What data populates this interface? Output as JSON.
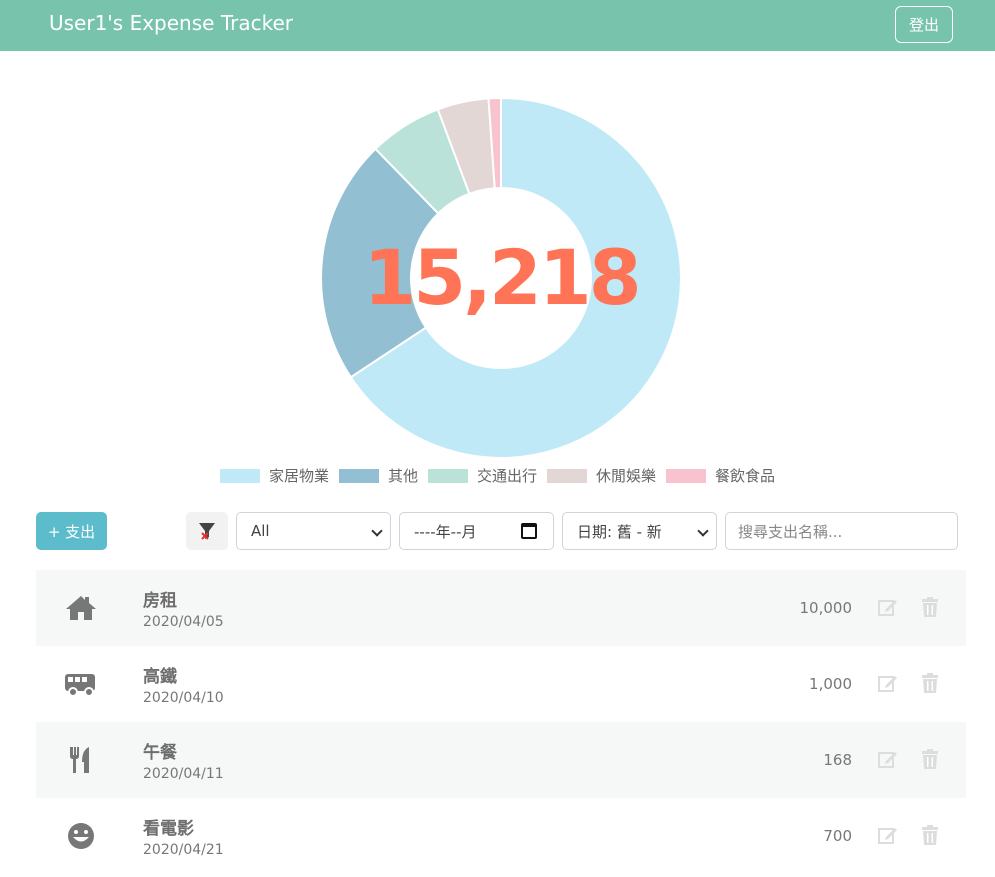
{
  "navbar": {
    "title": "User1's Expense Tracker",
    "logout_label": "登出"
  },
  "chart_data": {
    "type": "pie",
    "center_label": "15,218",
    "categories": [
      "家居物業",
      "其他",
      "交通出行",
      "休閒娛樂",
      "餐飲食品"
    ],
    "values": [
      10000,
      3350,
      1000,
      700,
      168
    ],
    "colors": [
      "#c0e9f8",
      "#92c0d2",
      "#bbe2d9",
      "#e2d7d5",
      "#f9c2cf"
    ],
    "legend_position": "bottom"
  },
  "toolbar": {
    "add_label": "+ 支出",
    "category_value": "All",
    "month_value": "----年--月",
    "sort_value": "日期: 舊 - 新",
    "search_placeholder": "搜尋支出名稱..."
  },
  "expenses": [
    {
      "name": "房租",
      "date": "2020/04/05",
      "amount": "10,000",
      "icon": "home-icon"
    },
    {
      "name": "高鐵",
      "date": "2020/04/10",
      "amount": "1,000",
      "icon": "shuttle-van-icon"
    },
    {
      "name": "午餐",
      "date": "2020/04/11",
      "amount": "168",
      "icon": "utensils-icon"
    },
    {
      "name": "看電影",
      "date": "2020/04/21",
      "amount": "700",
      "icon": "grin-icon"
    }
  ]
}
